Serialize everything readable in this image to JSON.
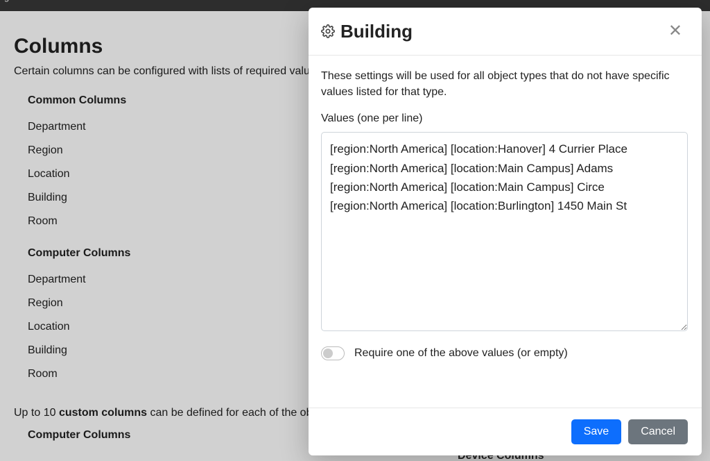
{
  "topbar": {
    "fragment": "gs"
  },
  "page": {
    "title": "Columns",
    "description": "Certain columns can be configured with lists of required values.",
    "common_title": "Common Columns",
    "common_items": [
      "Department",
      "Region",
      "Location",
      "Building",
      "Room"
    ],
    "computer_title": "Computer Columns",
    "computer_items": [
      "Department",
      "Region",
      "Location",
      "Building",
      "Room"
    ],
    "custom_note_prefix": "Up to 10 ",
    "custom_note_bold": "custom columns",
    "custom_note_suffix": " can be defined for each of the object types.",
    "computer_title2": "Computer Columns",
    "device_title2": "Device Columns"
  },
  "modal": {
    "title": "Building",
    "description": "These settings will be used for all object types that do not have specific values listed for that type.",
    "values_label": "Values (one per line)",
    "values_text": "[region:North America] [location:Hanover] 4 Currier Place\n[region:North America] [location:Main Campus] Adams\n[region:North America] [location:Main Campus] Circe\n[region:North America] [location:Burlington] 1450 Main St",
    "toggle_label": "Require one of the above values (or empty)",
    "toggle_on": false,
    "save_label": "Save",
    "cancel_label": "Cancel",
    "gear_icon": "gear-icon",
    "close_icon": "close-icon"
  }
}
